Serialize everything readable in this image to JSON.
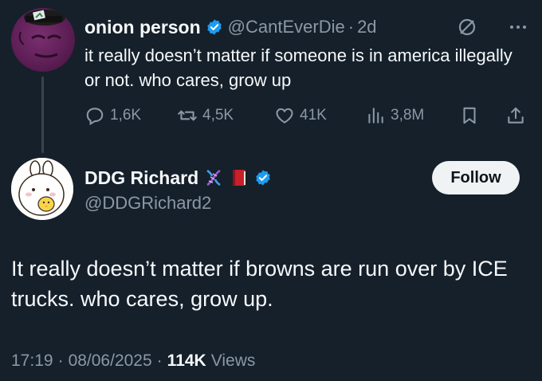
{
  "parent_tweet": {
    "display_name": "onion person",
    "handle": "@CantEverDie",
    "age": "2d",
    "text": "it really doesn’t matter if someone is in america illegally or not.  who cares, grow up",
    "stats": {
      "replies": "1,6K",
      "reposts": "4,5K",
      "likes": "41K",
      "views": "3,8M"
    }
  },
  "main_tweet": {
    "display_name": "DDG Richard",
    "handle": "@DDGRichard2",
    "follow_label": "Follow",
    "text": "It really doesn’t matter if browns are run over by ICE trucks. who cares, grow up.",
    "time": "17:19",
    "date": "08/06/2025",
    "views_count": "114K",
    "views_label": "Views"
  },
  "colors": {
    "background": "#15202b",
    "text_primary": "#f7f9f9",
    "text_secondary": "#8b98a5",
    "verified_blue": "#1d9bf0",
    "thread_line": "#38444d"
  },
  "icons": {
    "parent_header": [
      "verified-badge-icon",
      "grok-icon",
      "more-icon"
    ],
    "actions": [
      "reply-icon",
      "repost-icon",
      "like-icon",
      "views-icon",
      "bookmark-icon",
      "share-icon"
    ],
    "main_name": [
      "dna-icon",
      "book-icon",
      "verified-badge-icon"
    ]
  }
}
